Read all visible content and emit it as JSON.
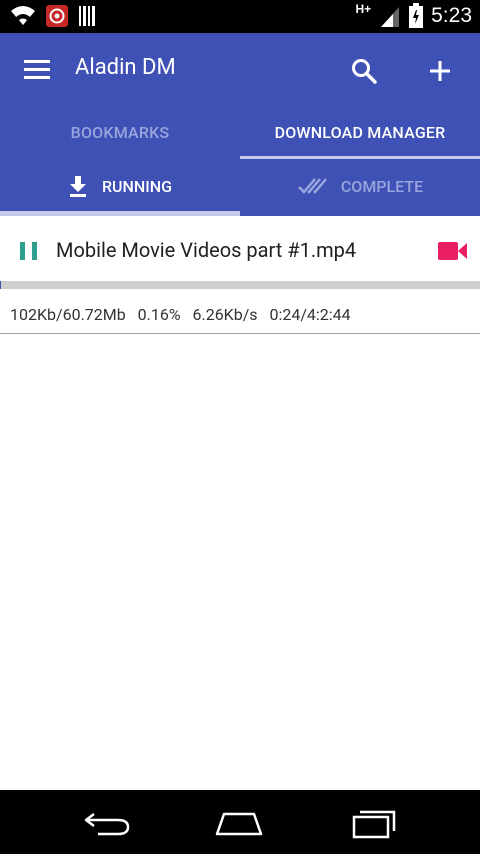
{
  "status_bar": {
    "time": "5:23",
    "network_type": "H+",
    "icons": [
      "wifi-icon",
      "notification-app-icon",
      "barcode-icon",
      "signal-icon",
      "battery-icon"
    ]
  },
  "toolbar": {
    "title": "Aladin DM",
    "menu_icon": "menu-icon",
    "search_icon": "search-icon",
    "add_icon": "add-icon"
  },
  "main_tabs": [
    {
      "label": "BOOKMARKS",
      "selected": false
    },
    {
      "label": "DOWNLOAD MANAGER",
      "selected": true
    }
  ],
  "sub_tabs": [
    {
      "label": "RUNNING",
      "icon": "download-icon",
      "selected": true
    },
    {
      "label": "COMPLETE",
      "icon": "double-check-icon",
      "selected": false
    }
  ],
  "downloads": [
    {
      "file_name": "Mobile Movie Videos part #1.mp4",
      "status_icon": "pause-icon",
      "type_icon": "video-camera-icon",
      "progress_fraction": 0.0016,
      "downloaded": "102Kb/60.72Mb",
      "percent": "0.16%",
      "speed": "6.26Kb/s",
      "time": "0:24/4:2:44"
    }
  ],
  "nav_bar": {
    "icons": [
      "back-icon",
      "home-icon",
      "recents-icon"
    ]
  },
  "colors": {
    "app_bar": "#3f51b5",
    "tab_inactive": "#9aa5de",
    "tab_indicator": "#c5cae9",
    "pause_icon": "#2e9e8f",
    "video_icon": "#e91e63",
    "progress_track": "#cfcfcf"
  }
}
